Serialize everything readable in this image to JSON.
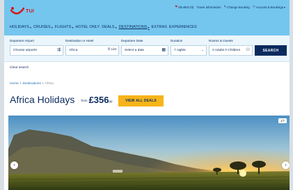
{
  "brand": {
    "name": "TUI",
    "color": "#cf1b22"
  },
  "header": {
    "utilities": [
      {
        "label": "Shortlist (0)",
        "icon": "heart-icon"
      },
      {
        "label": "Travel Information",
        "icon": ""
      },
      {
        "label": "Change Booking",
        "icon": "pencil-icon"
      },
      {
        "label": "Account & Bookings",
        "icon": "user-icon"
      }
    ],
    "nav": [
      {
        "label": "HOLIDAYS",
        "has_menu": true
      },
      {
        "label": "CRUISES",
        "has_menu": true
      },
      {
        "label": "FLIGHTS",
        "has_menu": true
      },
      {
        "label": "HOTEL ONLY",
        "has_menu": false
      },
      {
        "label": "DEALS",
        "has_menu": true
      },
      {
        "label": "DESTINATIONS",
        "has_menu": true
      },
      {
        "label": "EXTRAS",
        "has_menu": false
      },
      {
        "label": "EXPERIENCES",
        "has_menu": false
      }
    ]
  },
  "search": {
    "departure_airport": {
      "label": "Departure Airport",
      "value": "Choose airports"
    },
    "destination": {
      "label": "Destination or Hotel",
      "value": "Africa",
      "action": "List"
    },
    "departure_date": {
      "label": "Departure Date",
      "value": "Select a date"
    },
    "duration": {
      "label": "Duration",
      "value": "7 nights"
    },
    "rooms_guests": {
      "label": "Rooms & Guests",
      "value": "2 Adults 0 Children"
    },
    "button": "SEARCH",
    "clear": "Clear search"
  },
  "breadcrumb": [
    "Home",
    "Destinations",
    "Africa"
  ],
  "page": {
    "title": "Africa Holidays",
    "from_label": "from",
    "price": "£356",
    "price_suffix": "pp",
    "deals_button": "VIEW ALL DEALS"
  },
  "carousel": {
    "counter": "1/7"
  },
  "colors": {
    "header_bg": "#74c6ee",
    "navy": "#0a2a5e",
    "cta_yellow": "#f7b419",
    "search_bg": "#eaf6fc"
  }
}
